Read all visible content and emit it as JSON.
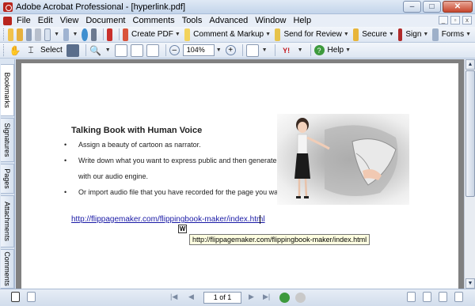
{
  "window": {
    "title": "Adobe Acrobat Professional - [hyperlink.pdf]",
    "controls": {
      "minimize": "–",
      "maximize": "□",
      "close": "✕"
    }
  },
  "menu": {
    "items": [
      "File",
      "Edit",
      "View",
      "Document",
      "Comments",
      "Tools",
      "Advanced",
      "Window",
      "Help"
    ],
    "doc_controls": {
      "minimize": "_",
      "restore": "▫",
      "close": "x"
    }
  },
  "toolbar1": {
    "create_pdf": "Create PDF",
    "comment_markup": "Comment & Markup",
    "send_for_review": "Send for Review",
    "secure": "Secure",
    "sign": "Sign",
    "forms": "Forms"
  },
  "toolbar2": {
    "select": "Select",
    "zoom_value": "104%",
    "help": "Help"
  },
  "side_tabs": [
    "Bookmarks",
    "Signatures",
    "Pages",
    "Attachments",
    "Comments"
  ],
  "document": {
    "heading": "Talking Book with Human Voice",
    "bullets": [
      "Assign a beauty of cartoon as narrator.",
      "Write down what you want to express public and then generate audio",
      "with our audio engine.",
      "Or import audio file that you have recorded for the page you want."
    ],
    "link": "http://flippagemaker.com/flippingbook-maker/index.html",
    "tooltip": "http://flippagemaker.com/flippingbook-maker/index.html",
    "cursor_label": "W"
  },
  "statusbar": {
    "page_indicator": "1 of 1"
  },
  "colors": {
    "link": "#1a1aa6",
    "accent_red": "#b8251d",
    "tooltip_bg": "#ffffe1"
  }
}
